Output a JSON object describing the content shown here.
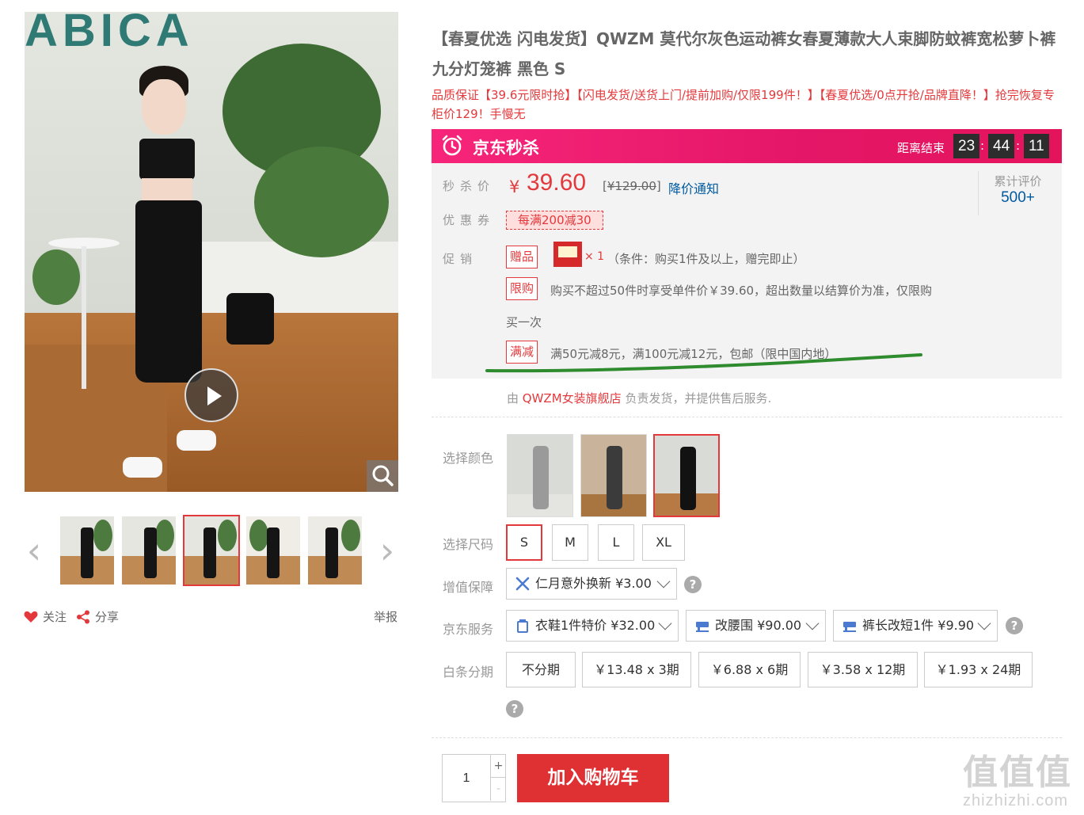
{
  "gallery": {
    "thumb_prev": "‹",
    "thumb_next": "›",
    "follow_label": "关注",
    "share_label": "分享",
    "report_label": "举报",
    "sign_text": "ABICA"
  },
  "product": {
    "title": "【春夏优选 闪电发货】QWZM 莫代尔灰色运动裤女春夏薄款大人束脚防蚊裤宽松萝卜裤九分灯笼裤 黑色 S",
    "promo_text": "品质保证【39.6元限时抢】【闪电发货/送货上门/提前加购/仅限199件！】【春夏优选/0点开抢/品牌直降！】抢完恢复专柜价129！手慢无"
  },
  "seckill": {
    "label": "京东秒杀",
    "countdown_label": "距离结束",
    "hours": "23",
    "minutes": "44",
    "seconds": "11",
    "sep": ":"
  },
  "price": {
    "label": "秒杀价",
    "currency": "¥",
    "value": "39.60",
    "original_prefix": "[",
    "original": "¥129.00",
    "original_suffix": "]",
    "notice_link": "降价通知",
    "review_label": "累计评价",
    "review_count": "500+"
  },
  "coupon": {
    "label": "优惠券",
    "value": "每满200减30"
  },
  "promotion": {
    "label": "促销",
    "gift_tag": "赠品",
    "gift_qty": "× 1",
    "gift_condition": "（条件：购买1件及以上，赠完即止）",
    "limit_tag": "限购",
    "limit_text_1": "购买不超过50件时享受单件价￥39.60，超出数量以结算价为准，仅限购",
    "limit_text_2": "买一次",
    "reduce_tag": "满减",
    "reduce_text": "满50元减8元，满100元减12元，包邮（限中国内地）"
  },
  "shop": {
    "prefix": "由",
    "name": "QWZM女装旗舰店",
    "suffix": "负责发货，并提供售后服务."
  },
  "options": {
    "color_label": "选择颜色",
    "size_label": "选择尺码",
    "sizes": [
      "S",
      "M",
      "L",
      "XL"
    ],
    "guarantee_label": "增值保障",
    "guarantee": "仁月意外换新 ¥3.00",
    "service_label": "京东服务",
    "services": [
      "衣鞋1件特价 ¥32.00",
      "改腰围 ¥90.00",
      "裤长改短1件 ¥9.90"
    ],
    "installment_label": "白条分期",
    "installments": [
      "不分期",
      "￥13.48 x 3期",
      "￥6.88 x 6期",
      "￥3.58 x 12期",
      "￥1.93 x 24期"
    ],
    "help": "?"
  },
  "purchase": {
    "quantity": "1",
    "plus": "+",
    "minus": "-",
    "cart_label": "加入购物车"
  },
  "watermark": {
    "big": "值值值",
    "small": "zhizhizhi.com"
  },
  "colors": {
    "accent": "#e4393c",
    "link": "#005aa0",
    "seckill_start": "#f7257a",
    "seckill_end": "#e4145c",
    "annotation_green": "#2e8b2e"
  }
}
